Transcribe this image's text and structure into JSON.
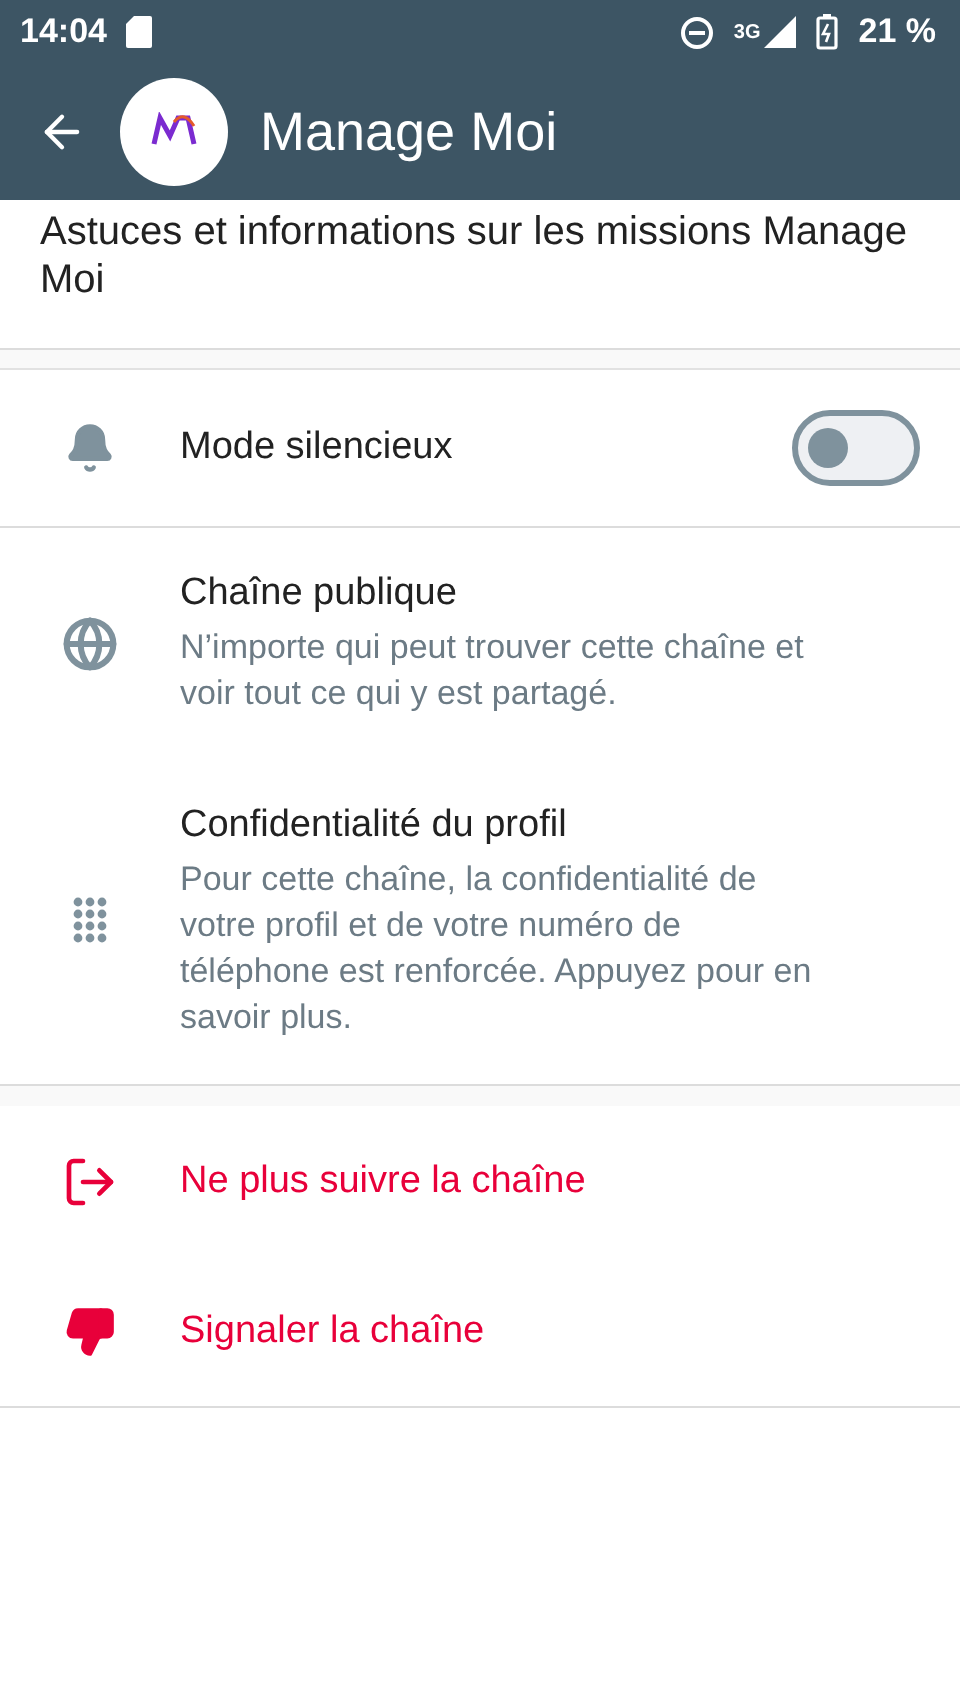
{
  "status_bar": {
    "time": "14:04",
    "network": "3G",
    "battery": "21 %"
  },
  "app_bar": {
    "title": "Manage Moi"
  },
  "description": "Astuces et informations sur les missions Manage Moi",
  "settings": [
    {
      "kind": "toggle",
      "title": "Mode silencieux",
      "on": false
    },
    {
      "kind": "info",
      "title": "Chaîne publique",
      "subtitle": "N’importe qui peut trouver cette chaîne et voir tout ce qui y est partagé."
    },
    {
      "kind": "info",
      "title": "Confidentialité du profil",
      "subtitle": "Pour cette chaîne, la confidentialité de votre profil et de votre numéro de téléphone est renforcée. Appuyez pour en savoir plus."
    }
  ],
  "actions": [
    {
      "label": "Ne plus suivre la chaîne"
    },
    {
      "label": "Signaler la chaîne"
    }
  ]
}
